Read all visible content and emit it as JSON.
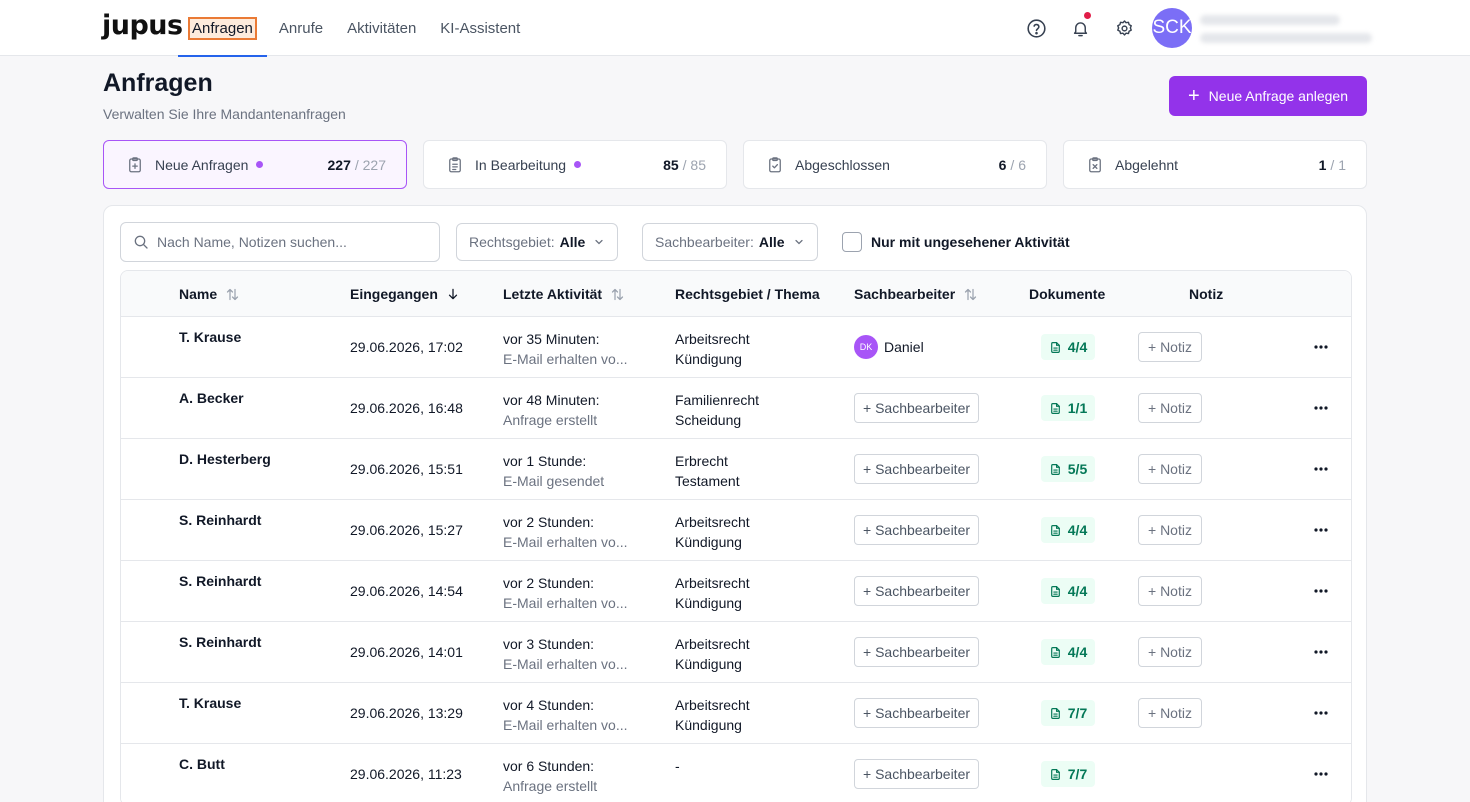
{
  "app": {
    "logo": "jupus"
  },
  "nav": {
    "items": [
      {
        "label": "Anfragen",
        "active": true
      },
      {
        "label": "Anrufe"
      },
      {
        "label": "Aktivitäten"
      },
      {
        "label": "KI-Assistent"
      }
    ]
  },
  "user": {
    "initials": "SCK"
  },
  "colors": {
    "accent": "#9333ea",
    "active_tab_underline": "#2563eb",
    "notification": "#e11d48",
    "doc_badge": "#047857"
  },
  "header": {
    "title": "Anfragen",
    "subtitle": "Verwalten Sie Ihre Mandantenanfragen",
    "new_button": "Neue Anfrage anlegen"
  },
  "status_cards": [
    {
      "label": "Neue Anfragen",
      "count": "227",
      "total": "/ 227",
      "dot": true,
      "active": true,
      "icon": "clipboard-plus-icon"
    },
    {
      "label": "In Bearbeitung",
      "count": "85",
      "total": "/ 85",
      "dot": true,
      "icon": "clipboard-list-icon"
    },
    {
      "label": "Abgeschlossen",
      "count": "6",
      "total": "/ 6",
      "dot": false,
      "icon": "clipboard-check-icon"
    },
    {
      "label": "Abgelehnt",
      "count": "1",
      "total": "/ 1",
      "dot": false,
      "icon": "clipboard-x-icon"
    }
  ],
  "filters": {
    "search_placeholder": "Nach Name, Notizen suchen...",
    "rechtsgebiet_label": "Rechtsgebiet:",
    "rechtsgebiet_value": "Alle",
    "sachbearbeiter_label": "Sachbearbeiter:",
    "sachbearbeiter_value": "Alle",
    "unseen_checkbox": "Nur mit ungesehener Aktivität"
  },
  "table": {
    "headers": {
      "name": "Name",
      "received": "Eingegangen",
      "activity": "Letzte Aktivität",
      "area": "Rechtsgebiet / Thema",
      "agent": "Sachbearbeiter",
      "docs": "Dokumente",
      "note": "Notiz"
    },
    "add_agent_label": "+ Sachbearbeiter",
    "add_note_label": "+ Notiz",
    "rows": [
      {
        "name": "T. Krause",
        "date": "29.06.2026, 17:02",
        "activity": "vor 35 Minuten:",
        "activity_detail": "E-Mail erhalten vo...",
        "area": "Arbeitsrecht",
        "topic": "Kündigung",
        "agent": "Daniel",
        "agent_initials": "DK",
        "docs": "4/4",
        "has_note_btn": true
      },
      {
        "name": "A. Becker",
        "date": "29.06.2026, 16:48",
        "activity": "vor 48 Minuten:",
        "activity_detail": "Anfrage erstellt",
        "area": "Familienrecht",
        "topic": "Scheidung",
        "agent": null,
        "docs": "1/1",
        "has_note_btn": true
      },
      {
        "name": "D. Hesterberg",
        "date": "29.06.2026, 15:51",
        "activity": "vor 1 Stunde:",
        "activity_detail": "E-Mail gesendet",
        "area": "Erbrecht",
        "topic": "Testament",
        "agent": null,
        "docs": "5/5",
        "has_note_btn": true
      },
      {
        "name": "S. Reinhardt",
        "date": "29.06.2026, 15:27",
        "activity": "vor 2 Stunden:",
        "activity_detail": "E-Mail erhalten vo...",
        "area": "Arbeitsrecht",
        "topic": "Kündigung",
        "agent": null,
        "docs": "4/4",
        "has_note_btn": true
      },
      {
        "name": "S. Reinhardt",
        "date": "29.06.2026, 14:54",
        "activity": "vor 2 Stunden:",
        "activity_detail": "E-Mail erhalten vo...",
        "area": "Arbeitsrecht",
        "topic": "Kündigung",
        "agent": null,
        "docs": "4/4",
        "has_note_btn": true
      },
      {
        "name": "S. Reinhardt",
        "date": "29.06.2026, 14:01",
        "activity": "vor 3 Stunden:",
        "activity_detail": "E-Mail erhalten vo...",
        "area": "Arbeitsrecht",
        "topic": "Kündigung",
        "agent": null,
        "docs": "4/4",
        "has_note_btn": true
      },
      {
        "name": "T. Krause",
        "date": "29.06.2026, 13:29",
        "activity": "vor 4 Stunden:",
        "activity_detail": "E-Mail erhalten vo...",
        "area": "Arbeitsrecht",
        "topic": "Kündigung",
        "agent": null,
        "docs": "7/7",
        "has_note_btn": true
      },
      {
        "name": "C. Butt",
        "date": "29.06.2026, 11:23",
        "activity": "vor 6 Stunden:",
        "activity_detail": "Anfrage erstellt",
        "area": "-",
        "topic": "",
        "agent": null,
        "docs": "7/7",
        "has_note_btn": false
      }
    ]
  }
}
